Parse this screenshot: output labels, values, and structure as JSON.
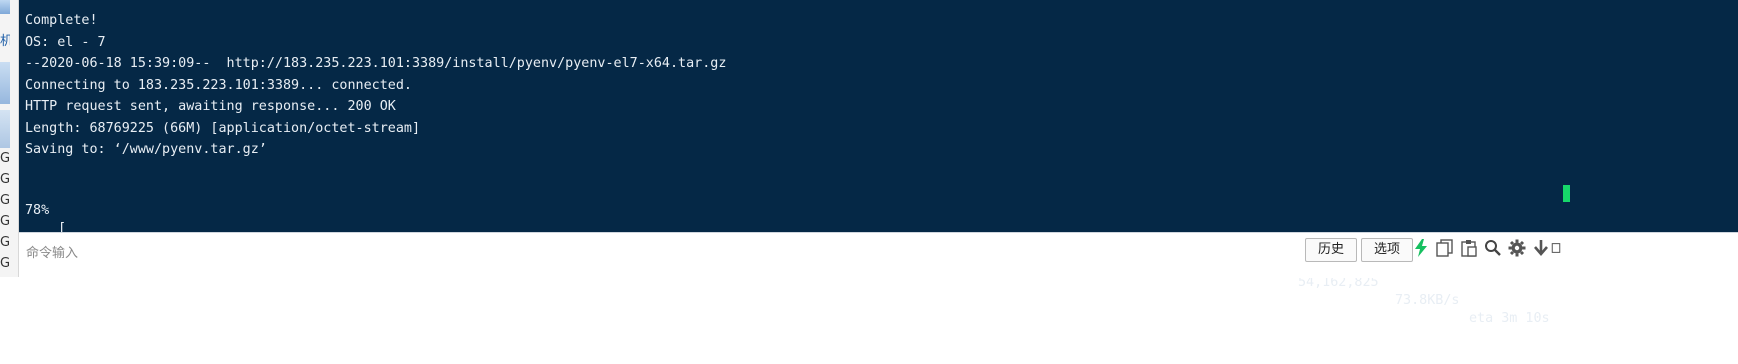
{
  "left_panel": {
    "glyph_char": "机",
    "letters": [
      "G",
      "G",
      "G",
      "G",
      "G",
      "G"
    ]
  },
  "terminal": {
    "lines": [
      "Complete!",
      "OS: el - 7",
      "--2020-06-18 15:39:09--  http://183.235.223.101:3389/install/pyenv/pyenv-el7-x64.tar.gz",
      "Connecting to 183.235.223.101:3389... connected.",
      "HTTP request sent, awaiting response... 200 OK",
      "Length: 68769225 (66M) [application/octet-stream]",
      "Saving to: ‘/www/pyenv.tar.gz’"
    ],
    "progress": {
      "percent_text": "78%",
      "percent": 78,
      "open_bracket": "[",
      "bar": "=========================================================================================================================================>",
      "close_bracket": "]",
      "bytes": "54,162,825",
      "rate": "73.8KB/s",
      "eta": "eta 3m 10s"
    },
    "colors": {
      "background": "#052846",
      "text": "#e8eef4",
      "cursor": "#16d86a"
    }
  },
  "command_bar": {
    "placeholder": "命令输入",
    "history_label": "历史",
    "options_label": "选项",
    "icons": [
      "flash-icon",
      "copy-icon",
      "paste-icon",
      "search-icon",
      "gear-icon",
      "download-icon",
      "upload-icon"
    ]
  }
}
